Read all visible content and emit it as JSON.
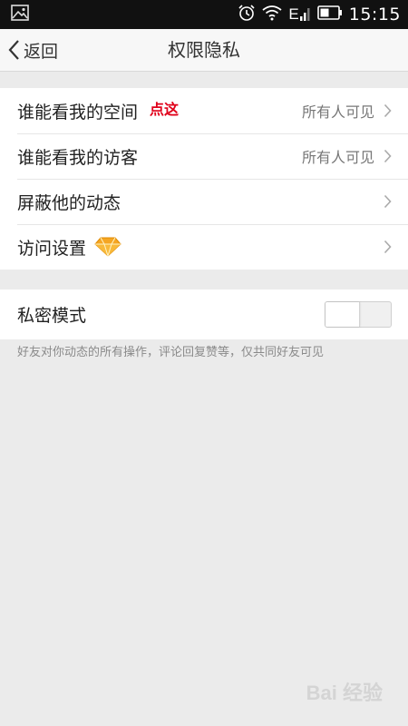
{
  "status_bar": {
    "time": "15:15",
    "network": "E",
    "icons": [
      "image-icon",
      "alarm-icon",
      "wifi-icon",
      "signal-icon",
      "battery-icon"
    ]
  },
  "header": {
    "back_label": "返回",
    "title": "权限隐私"
  },
  "settings": {
    "items": [
      {
        "label": "谁能看我的空间",
        "value": "所有人可见",
        "annotation": "点这"
      },
      {
        "label": "谁能看我的访客",
        "value": "所有人可见"
      },
      {
        "label": "屏蔽他的动态"
      },
      {
        "label": "访问设置",
        "icon": "diamond-icon"
      }
    ]
  },
  "privacy_mode": {
    "label": "私密模式",
    "enabled": false,
    "hint": "好友对你动态的所有操作，评论回复赞等，仅共同好友可见"
  },
  "watermark": {
    "text": "Bai 经验"
  },
  "colors": {
    "annotation": "#e0001a",
    "background": "#ebebeb",
    "diamond": "#f5a623"
  }
}
